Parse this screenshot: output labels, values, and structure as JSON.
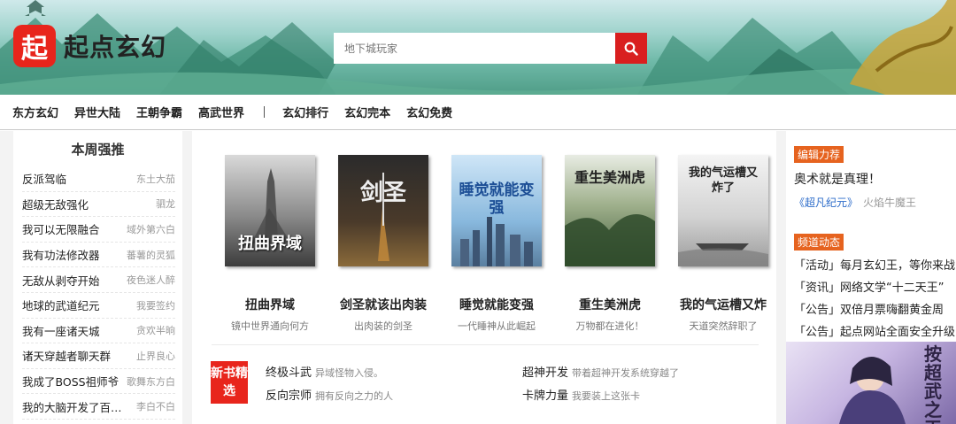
{
  "logo": {
    "mark": "起",
    "text": "起点玄幻"
  },
  "search": {
    "placeholder": "地下城玩家"
  },
  "nav": {
    "items_a": [
      "东方玄幻",
      "异世大陆",
      "王朝争霸",
      "高武世界"
    ],
    "items_b": [
      "玄幻排行",
      "玄幻完本",
      "玄幻免费"
    ]
  },
  "weekly": {
    "title": "本周强推",
    "items": [
      {
        "title": "反派驾临",
        "author": "东土大茄"
      },
      {
        "title": "超级无敌强化",
        "author": "驷龙"
      },
      {
        "title": "我可以无限融合",
        "author": "域外第六白"
      },
      {
        "title": "我有功法修改器",
        "author": "蕃薯的灵狐"
      },
      {
        "title": "无敌从剥夺开始",
        "author": "夜色迷人醉"
      },
      {
        "title": "地球的武道纪元",
        "author": "我要签约"
      },
      {
        "title": "我有一座诸天城",
        "author": "贪欢半晌"
      },
      {
        "title": "诸天穿越者聊天群",
        "author": "止界良心"
      },
      {
        "title": "我成了BOSS祖师爷",
        "author": "歌舞东方白"
      },
      {
        "title": "我的大脑开发了百…",
        "author": "李白不白"
      }
    ]
  },
  "books": [
    {
      "title": "扭曲界域",
      "desc": "镜中世界通向何方",
      "cover_title": "扭曲界域"
    },
    {
      "title": "剑圣就该出肉装",
      "desc": "出肉装的剑圣",
      "cover_title": "剑圣"
    },
    {
      "title": "睡觉就能变强",
      "desc": "一代睡神从此崛起",
      "cover_title": "睡觉就能变强"
    },
    {
      "title": "重生美洲虎",
      "desc": "万物都在进化！",
      "cover_title": "重生美洲虎"
    },
    {
      "title": "我的气运槽又炸",
      "desc": "天道突然辞职了",
      "cover_title": "我的气运槽又炸了"
    }
  ],
  "new_books": {
    "badge": "新书精选",
    "items": [
      {
        "name": "终极斗武",
        "desc": "异域怪物入侵。"
      },
      {
        "name": "超神开发",
        "desc": "带着超神开发系统穿越了"
      },
      {
        "name": "反向宗师",
        "desc": "拥有反向之力的人"
      },
      {
        "name": "卡牌力量",
        "desc": "我要装上这张卡"
      }
    ]
  },
  "editor": {
    "tag": "编辑力荐",
    "title": "奥术就是真理！",
    "book": "《超凡纪元》",
    "author": "火焰牛魔王"
  },
  "news": {
    "tag": "频道动态",
    "items": [
      "「活动」每月玄幻王，等你来战",
      "「资讯」网络文学“十二天王”",
      "「公告」双倍月票嗨翻黄金周",
      "「公告」起点网站全面安全升级"
    ]
  },
  "ad": {
    "text": "按超武之天"
  },
  "colors": {
    "brand_red": "#e8251c",
    "tag_orange": "#e6631f",
    "link_blue": "#2a6ac9"
  }
}
